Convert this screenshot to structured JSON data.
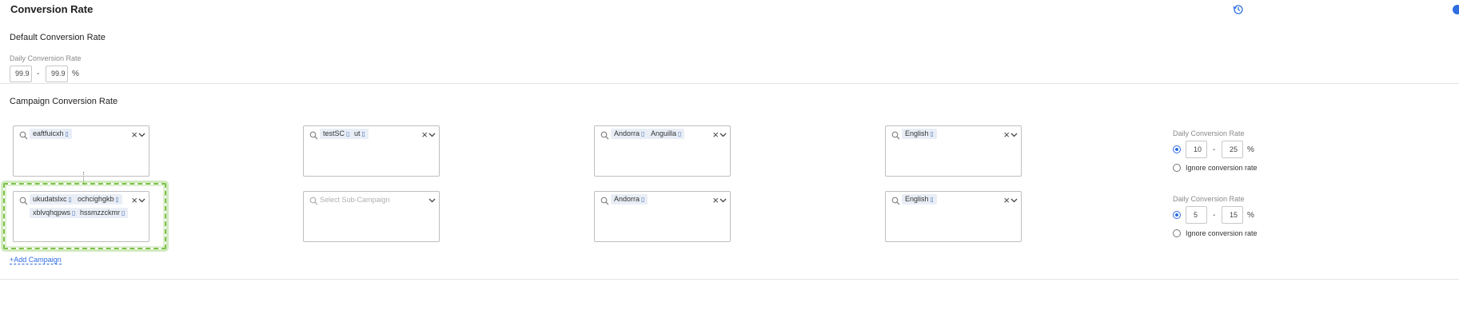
{
  "page": {
    "title": "Conversion Rate"
  },
  "header_icons": [
    "history-icon",
    "info-icon"
  ],
  "default_section": {
    "title": "Default Conversion Rate",
    "label": "Daily Conversion Rate",
    "min_value": "99.9",
    "separator": "-",
    "max_value": "99.9",
    "unit": "%"
  },
  "campaign_section": {
    "title": "Campaign Conversion Rate",
    "rows": [
      {
        "campaign_tags": [
          "eaftfuicxh"
        ],
        "subcampaign_tags": [
          "testSC",
          "ut"
        ],
        "subcampaign_placeholder": "",
        "country_tags": [
          "Andorra",
          "Anguilla"
        ],
        "language_tags": [
          "English"
        ],
        "rate_label": "Daily Conversion Rate",
        "rate_min": "10",
        "separator": "-",
        "rate_max": "25",
        "unit": "%",
        "ignore_label": "Ignore conversion rate"
      },
      {
        "campaign_tags": [
          "ukudatslxc",
          "ochcighgkb",
          "xblvqhqpws",
          "hssmzzckmr"
        ],
        "subcampaign_tags": [],
        "subcampaign_placeholder": "Select Sub-Campaign",
        "country_tags": [
          "Andorra"
        ],
        "language_tags": [
          "English"
        ],
        "rate_label": "Daily Conversion Rate",
        "rate_min": "5",
        "separator": "-",
        "rate_max": "15",
        "unit": "%",
        "ignore_label": "Ignore conversion rate"
      }
    ],
    "add_campaign_label": "+Add Campaign"
  },
  "colors": {
    "accent": "#2f6de1",
    "highlight": "#7dc24a",
    "tag_bg": "#e9eef6"
  }
}
